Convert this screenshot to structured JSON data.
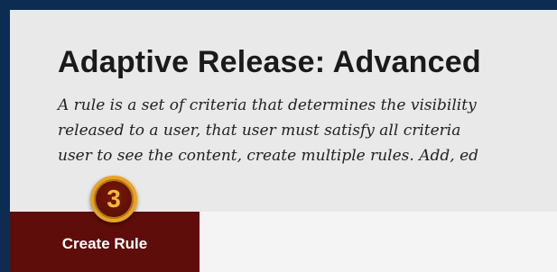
{
  "header": {
    "title": "Adaptive Release: Advanced",
    "description_lines": [
      "A rule is a set of criteria that determines the visibility",
      "released to a user, that user must satisfy all criteria",
      "user to see the content, create multiple rules. Add, ed"
    ]
  },
  "toolbar": {
    "create_rule_label": "Create Rule"
  },
  "callout": {
    "step_number": "3"
  },
  "colors": {
    "frame": "#0c2c52",
    "button": "#5e0d0a",
    "badge_ring": "#e6a327"
  }
}
